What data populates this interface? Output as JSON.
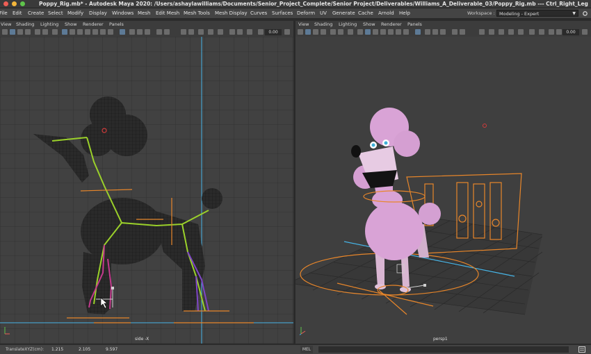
{
  "window": {
    "title": "Poppy_Rig.mb* - Autodesk Maya 2020: /Users/ashaylawilliams/Documents/Senior_Project_Complete/Senior Project/Deliverables/Williams_A_Deliverable_03/Poppy_Rig.mb  ---  Ctrl_Right_Leg",
    "colors": {
      "close": "#ee5e55",
      "minimize": "#f3b63b",
      "zoom": "#5fc44b"
    }
  },
  "menubar": {
    "items": [
      "File",
      "Edit",
      "Create",
      "Select",
      "Modify",
      "Display",
      "Windows",
      "Mesh",
      "Edit Mesh",
      "Mesh Tools",
      "Mesh Display",
      "Curves",
      "Surfaces",
      "Deform",
      "UV",
      "Generate",
      "Cache",
      "Arnold",
      "Help"
    ],
    "workspace_label": "Workspace :",
    "workspace_value": "Modeling - Expert"
  },
  "left_panel": {
    "menu": [
      "View",
      "Shading",
      "Lighting",
      "Show",
      "Renderer",
      "Panels"
    ],
    "field_value": "0.00",
    "camera_label": "side -X"
  },
  "right_panel": {
    "menu": [
      "View",
      "Shading",
      "Lighting",
      "Show",
      "Renderer",
      "Panels"
    ],
    "field_value": "0.00",
    "camera_label": "persp1"
  },
  "status": {
    "label": "TranslateXYZ(cm):",
    "x": "1.215",
    "y": "2.105",
    "z": "9.597",
    "mel": "MEL"
  },
  "accent_colors": {
    "joint": "#9bd12a",
    "control": "#e8862a",
    "ground_line": "#46b4e6",
    "poodle_pink": "#d9a3d6"
  }
}
